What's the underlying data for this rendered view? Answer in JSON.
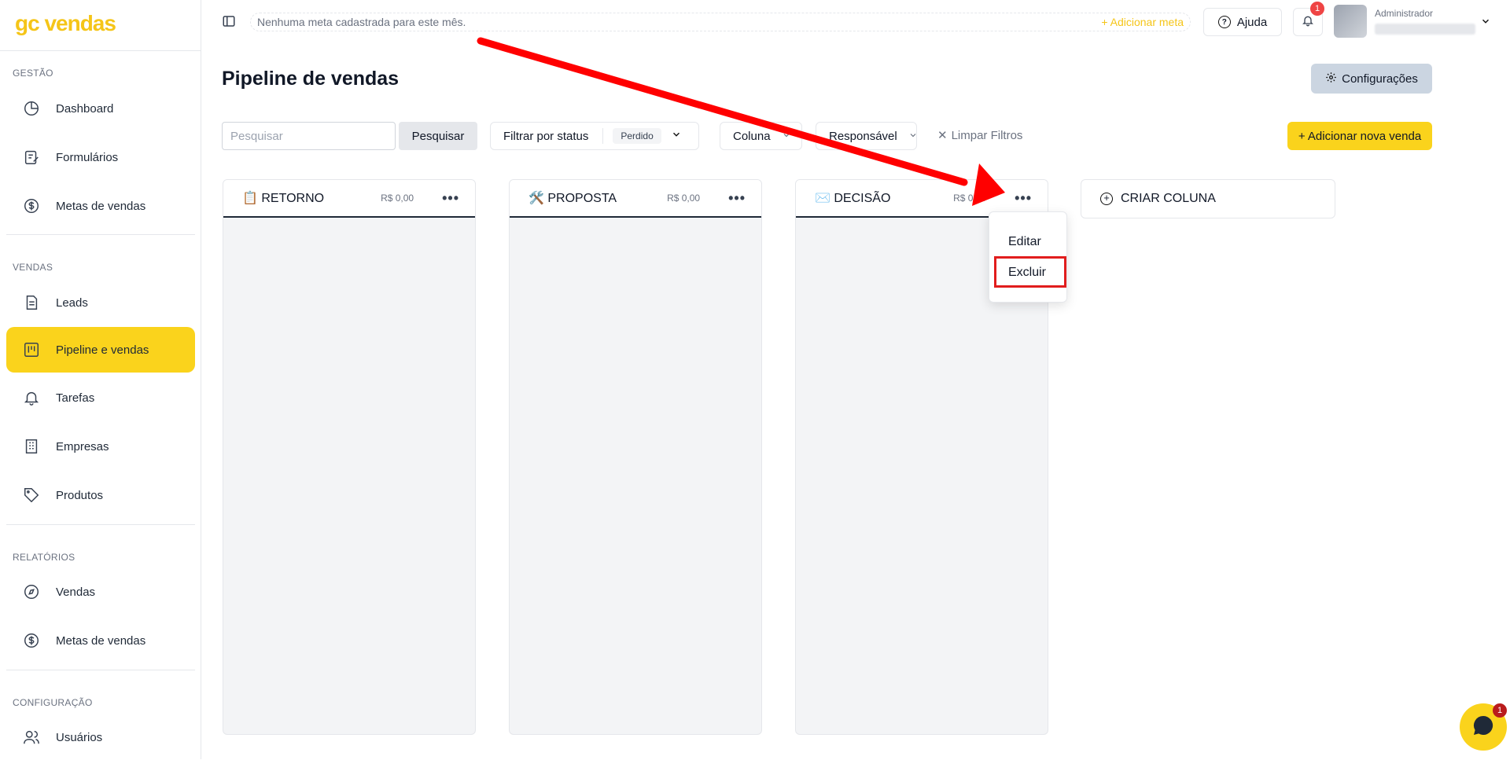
{
  "app": {
    "logo": "gc vendas"
  },
  "sidebar": {
    "sections": [
      {
        "label": "GESTÃO"
      },
      {
        "label": "VENDAS"
      },
      {
        "label": "RELATÓRIOS"
      },
      {
        "label": "CONFIGURAÇÃO"
      }
    ],
    "items": [
      {
        "label": "Dashboard",
        "icon": "pie-chart-icon"
      },
      {
        "label": "Formulários",
        "icon": "form-edit-icon"
      },
      {
        "label": "Metas de vendas",
        "icon": "dollar-circle-icon"
      },
      {
        "label": "Leads",
        "icon": "document-icon"
      },
      {
        "label": "Pipeline e vendas",
        "icon": "kanban-icon",
        "active": true
      },
      {
        "label": "Tarefas",
        "icon": "bell-icon"
      },
      {
        "label": "Empresas",
        "icon": "building-icon"
      },
      {
        "label": "Produtos",
        "icon": "tag-icon"
      },
      {
        "label": "Vendas",
        "icon": "compass-icon"
      },
      {
        "label": "Metas de vendas",
        "icon": "dollar-circle-icon"
      },
      {
        "label": "Usuários",
        "icon": "users-icon"
      }
    ]
  },
  "topbar": {
    "goal_text": "Nenhuma meta cadastrada para este mês.",
    "goal_add": "+ Adicionar meta",
    "help_label": "Ajuda",
    "notification_count": "1",
    "user_role": "Administrador"
  },
  "header": {
    "title": "Pipeline de vendas",
    "config_label": "Configurações"
  },
  "filters": {
    "search_placeholder": "Pesquisar",
    "search_button": "Pesquisar",
    "status_label": "Filtrar por status",
    "status_value": "Perdido",
    "column_label": "Coluna",
    "owner_label": "Responsável",
    "clear_label": "Limpar Filtros",
    "add_sale_label": "+ Adicionar nova venda"
  },
  "columns": [
    {
      "title": "📋 RETORNO",
      "amount": "R$ 0,00"
    },
    {
      "title": "🛠️ PROPOSTA",
      "amount": "R$ 0,00"
    },
    {
      "title": "✉️ DECISÃO",
      "amount": "R$ 0,00"
    }
  ],
  "create_column_label": "CRIAR COLUNA",
  "column_menu": {
    "edit": "Editar",
    "delete": "Excluir"
  },
  "chat": {
    "badge": "1"
  },
  "colors": {
    "accent": "#fad31c",
    "annotation": "#e11d1d"
  }
}
